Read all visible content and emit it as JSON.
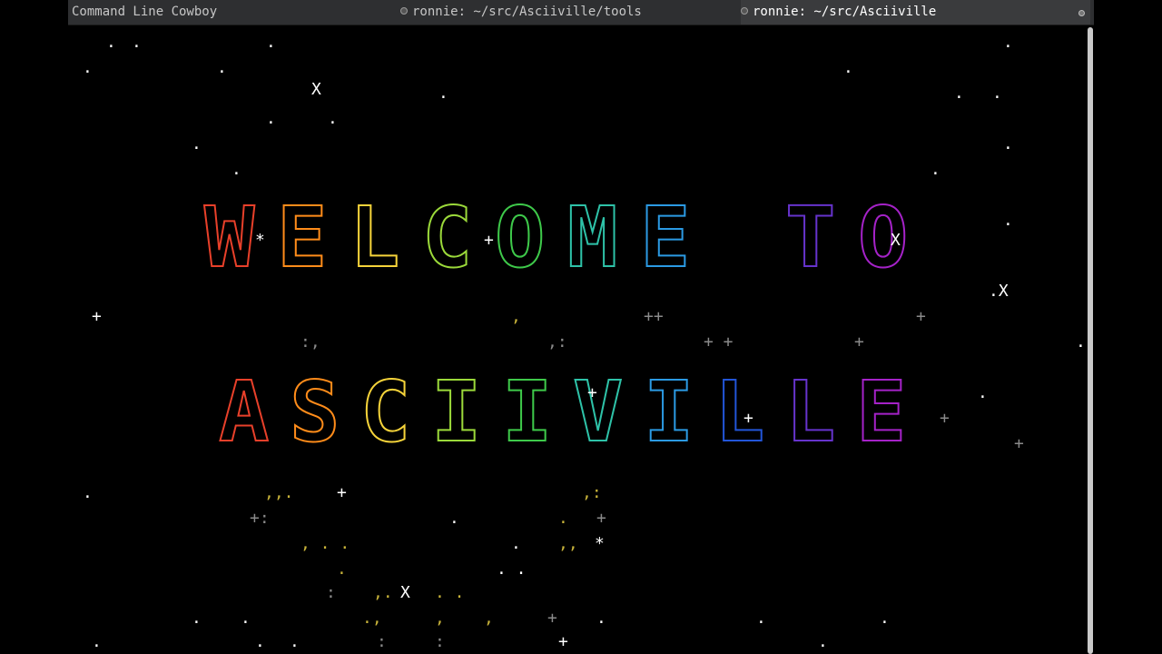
{
  "window": {
    "tabs": [
      {
        "title": "Command Line Cowboy",
        "active": false
      },
      {
        "title": "ronnie: ~/src/Asciiville/tools",
        "active": false
      },
      {
        "title": "ronnie: ~/src/Asciiville",
        "active": true
      }
    ]
  },
  "terminal": {
    "headline_1": "WELCOME TO",
    "headline_2": "ASCIIVILLE",
    "palette": [
      "#e8402a",
      "#ff8c1a",
      "#f5d33a",
      "#9bd93a",
      "#3ec94a",
      "#2ec2a8",
      "#2b9ae3",
      "#2255d8",
      "#6633cc",
      "#a522c8",
      "#d9248c",
      "#e8402a",
      "#ff8c1a"
    ],
    "star_color": "#ffffff",
    "dim_color": "#8a8a8a",
    "gold_color": "#c9b43a"
  }
}
